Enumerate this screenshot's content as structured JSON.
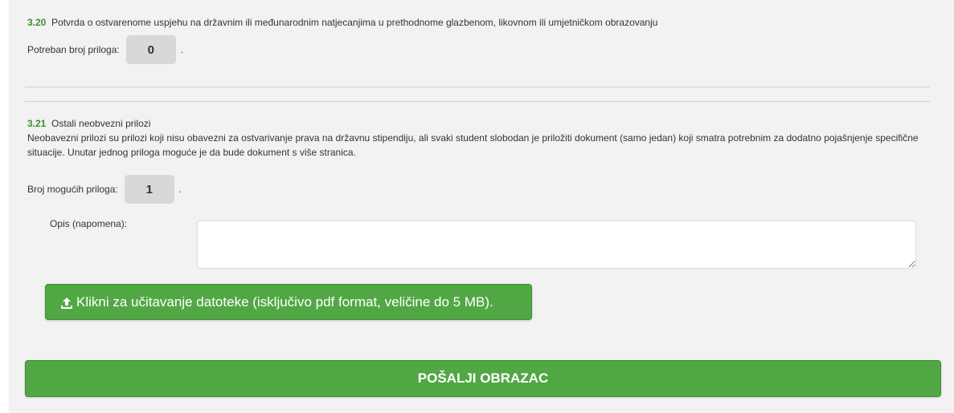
{
  "section_320": {
    "number": "3.20",
    "title": "Potvrda o ostvarenome uspjehu na državnim ili međunarodnim natjecanjima u prethodnome glazbenom, likovnom ili umjetničkom obrazovanju",
    "count_label": "Potreban broj priloga:",
    "count_value": "0",
    "count_suffix": "."
  },
  "section_321": {
    "number": "3.21",
    "title": "Ostali neobvezni prilozi",
    "description": "Neobavezni prilozi su prilozi koji nisu obavezni za ostvarivanje prava na državnu stipendiju, ali svaki student slobodan je priložiti dokument (samo jedan) koji smatra potrebnim za dodatno pojašnjenje specifične situacije. Unutar jednog priloga moguće je da bude dokument s više stranica.",
    "count_label": "Broj mogućih priloga:",
    "count_value": "1",
    "count_suffix": ".",
    "note_label": "Opis (napomena):",
    "note_value": "",
    "upload_label": "Klikni za učitavanje datoteke (isključivo pdf format, veličine do 5 MB)."
  },
  "submit_label": "POŠALJI OBRAZAC",
  "icons": {
    "upload": "upload-icon"
  },
  "colors": {
    "accent_green": "#52a745",
    "section_number": "#3f8f2f",
    "panel_bg": "#f2f2f2"
  }
}
